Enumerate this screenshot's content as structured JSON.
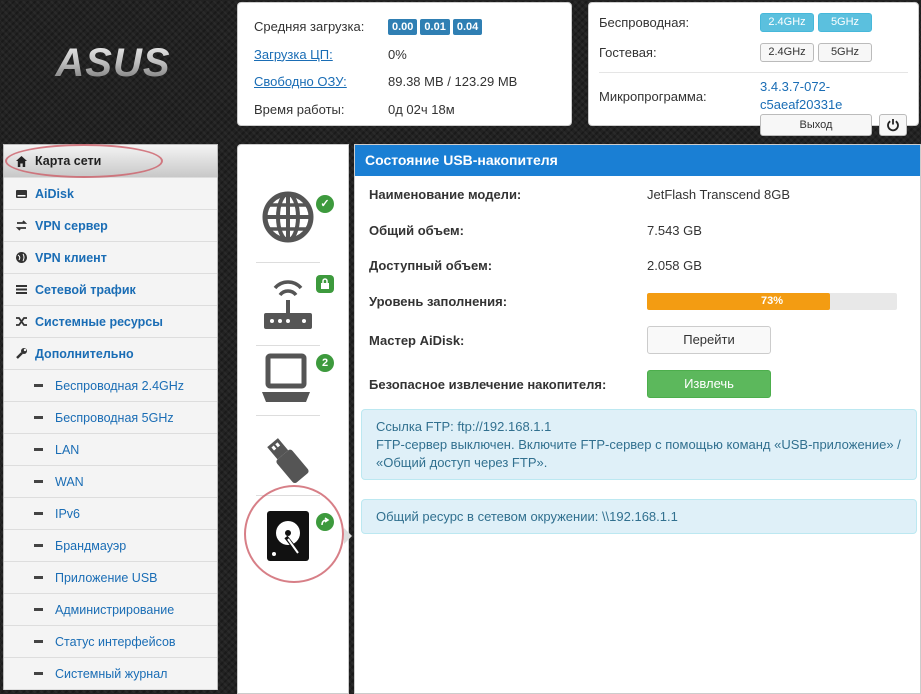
{
  "logo": {
    "text": "ASUS"
  },
  "stats": {
    "load_label": "Средняя загрузка:",
    "load_values": [
      "0.00",
      "0.01",
      "0.04"
    ],
    "cpu_label": "Загрузка ЦП:",
    "cpu_value": "0%",
    "ram_label": "Свободно ОЗУ:",
    "ram_value": "89.38 MB / 123.29 MB",
    "uptime_label": "Время работы:",
    "uptime_value": "0д 02ч 18м"
  },
  "radio": {
    "wireless_label": "Беспроводная:",
    "guest_label": "Гостевая:",
    "band_24": "2.4GHz",
    "band_5": "5GHz",
    "firmware_label": "Микропрограмма:",
    "firmware_line1": "3.4.3.7-072-",
    "firmware_line2": "c5aeaf20331e",
    "logout_label": "Выход"
  },
  "sidebar": {
    "items": [
      {
        "label": "Карта сети",
        "icon": "home-icon"
      },
      {
        "label": "AiDisk",
        "icon": "disk-icon"
      },
      {
        "label": "VPN сервер",
        "icon": "vpn-icon"
      },
      {
        "label": "VPN клиент",
        "icon": "globe-icon"
      },
      {
        "label": "Сетевой трафик",
        "icon": "traffic-icon"
      },
      {
        "label": "Системные ресурсы",
        "icon": "shuffle-icon"
      },
      {
        "label": "Дополнительно",
        "icon": "wrench-icon"
      }
    ],
    "sub": [
      "Беспроводная 2.4GHz",
      "Беспроводная 5GHz",
      "LAN",
      "WAN",
      "IPv6",
      "Брандмауэр",
      "Приложение USB",
      "Администрирование",
      "Статус интерфейсов",
      "Системный журнал"
    ]
  },
  "icons": {
    "clients_count": "2"
  },
  "main": {
    "title": "Состояние USB-накопителя",
    "model_label": "Наименование модели:",
    "model_value": "JetFlash Transcend 8GB",
    "total_label": "Общий объем:",
    "total_value": "7.543 GB",
    "free_label": "Доступный объем:",
    "free_value": "2.058 GB",
    "usage_label": "Уровень заполнения:",
    "usage_percent": 73,
    "usage_text": "73%",
    "usage_color": "#f39c12",
    "aidisk_label": "Мастер AiDisk:",
    "aidisk_button": "Перейти",
    "eject_label": "Безопасное извлечение накопителя:",
    "eject_button": "Извлечь",
    "ftp_line1": "Ссылка FTP: ftp://192.168.1.1",
    "ftp_line2": "FTP-сервер выключен. Включите FTP-сервер с помощью команд «USB-приложение» / «Общий доступ через FTP».",
    "share_line": "Общий ресурс в сетевом окружении: \\\\192.168.1.1"
  },
  "colors": {
    "accent": "#1a7fd4",
    "success": "#5cb85c",
    "info_bg": "#dff0f8",
    "badge": "#2f7fb3"
  }
}
